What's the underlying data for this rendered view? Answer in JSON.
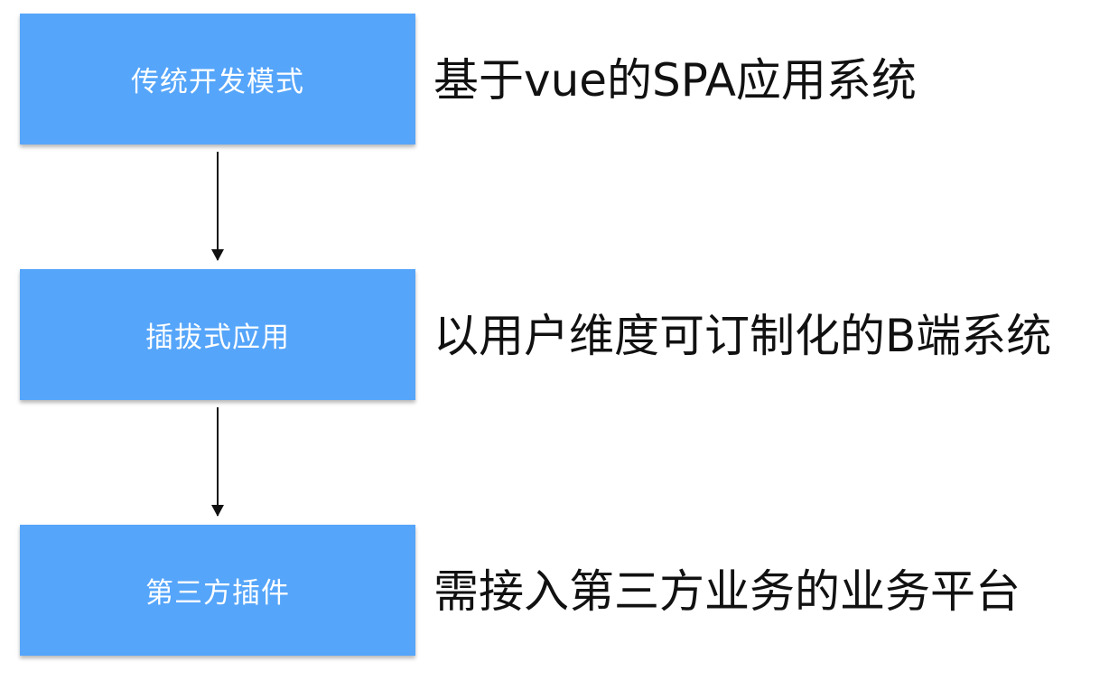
{
  "stages": [
    {
      "label": "传统开发模式",
      "description": "基于vue的SPA应用系统"
    },
    {
      "label": "插拔式应用",
      "description": "以用户维度可订制化的B端系统"
    },
    {
      "label": "第三方插件",
      "description": "需接入第三方业务的业务平台"
    }
  ],
  "colors": {
    "box_fill": "#55a5fa",
    "box_text": "#ffffff",
    "arrow": "#111111",
    "description_text": "#111111"
  }
}
